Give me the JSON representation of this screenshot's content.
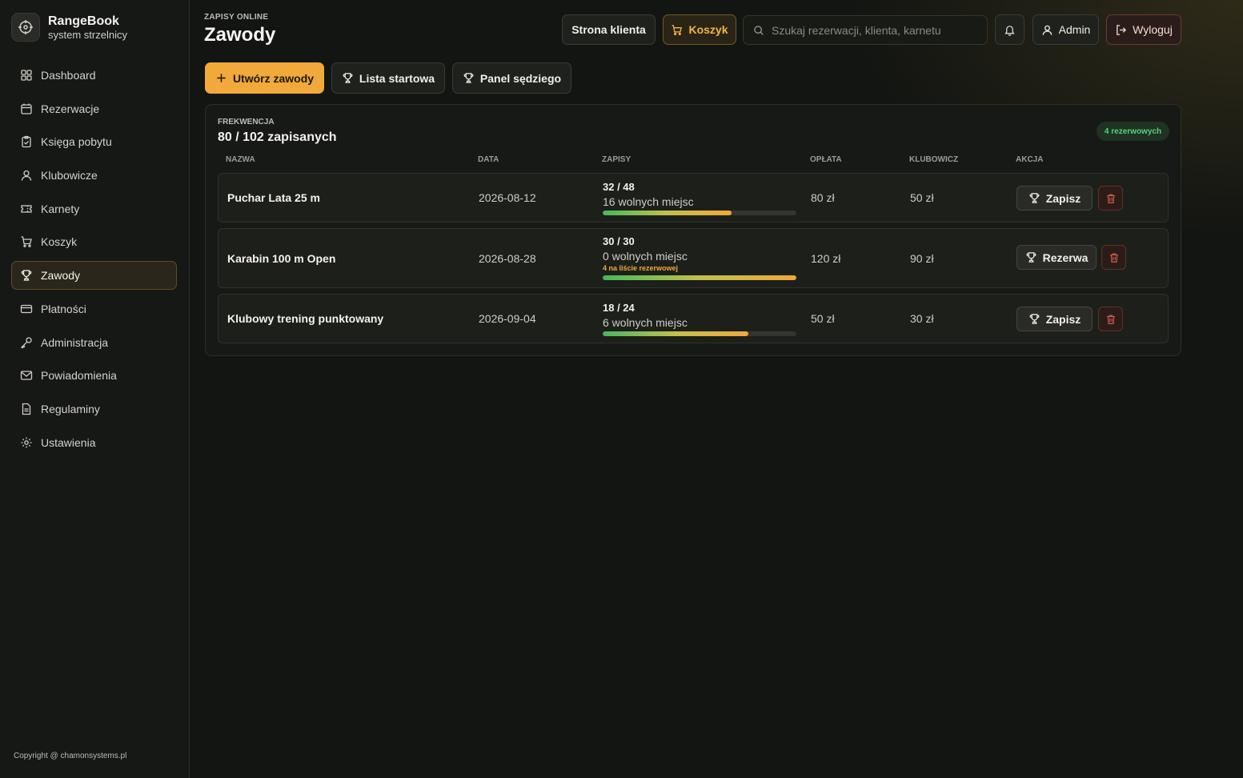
{
  "brand": {
    "name": "RangeBook",
    "subtitle": "system strzelnicy"
  },
  "sidebar": {
    "items": [
      {
        "label": "Dashboard",
        "icon": "dashboard-icon"
      },
      {
        "label": "Rezerwacje",
        "icon": "calendar-icon"
      },
      {
        "label": "Księga pobytu",
        "icon": "clipboard-icon"
      },
      {
        "label": "Klubowicze",
        "icon": "user-icon"
      },
      {
        "label": "Karnety",
        "icon": "ticket-icon"
      },
      {
        "label": "Koszyk",
        "icon": "cart-icon"
      },
      {
        "label": "Zawody",
        "icon": "trophy-icon",
        "active": true
      },
      {
        "label": "Płatności",
        "icon": "card-icon"
      },
      {
        "label": "Administracja",
        "icon": "key-icon"
      },
      {
        "label": "Powiadomienia",
        "icon": "mail-icon"
      },
      {
        "label": "Regulaminy",
        "icon": "document-icon"
      },
      {
        "label": "Ustawienia",
        "icon": "gear-icon"
      }
    ],
    "copyright": "Copyright @ chamonsystems.pl"
  },
  "header": {
    "eyebrow": "ZAPISY ONLINE",
    "title": "Zawody"
  },
  "topbar": {
    "client_label": "Strona klienta",
    "cart_label": "Koszyk",
    "search_placeholder": "Szukaj rezerwacji, klienta, karnetu",
    "admin_label": "Admin",
    "logout_label": "Wyloguj"
  },
  "actions": {
    "create_label": "Utwórz zawody",
    "list_label": "Lista startowa",
    "judge_label": "Panel sędziego"
  },
  "attendance": {
    "eyebrow": "FREKWENCJA",
    "title": "80 / 102 zapisanych",
    "badge": "4 rezerwowych"
  },
  "table": {
    "columns": [
      "NAZWA",
      "DATA",
      "ZAPISY",
      "OPŁATA",
      "KLUBOWICZ",
      "AKCJA"
    ],
    "rows": [
      {
        "name": "Puchar Lata 25 m",
        "date": "2026-08-12",
        "ratio": "32 / 48",
        "free": "16 wolnych miejsc",
        "fill_pct": 66.7,
        "fee": "80 zł",
        "member_fee": "50 zł",
        "action": "Zapisz"
      },
      {
        "name": "Karabin 100 m Open",
        "date": "2026-08-28",
        "ratio": "30 / 30",
        "free": "0 wolnych miejsc",
        "waitlist": "4 na liście rezerwowej",
        "fill_pct": 100,
        "fee": "120 zł",
        "member_fee": "90 zł",
        "action": "Rezerwa"
      },
      {
        "name": "Klubowy trening punktowany",
        "date": "2026-09-04",
        "ratio": "18 / 24",
        "free": "6 wolnych miejsc",
        "fill_pct": 75,
        "fee": "50 zł",
        "member_fee": "30 zł",
        "action": "Zapisz"
      }
    ]
  },
  "colors": {
    "accent": "#f0a93a",
    "success": "#5bd07a",
    "danger": "#d0624c",
    "background": "#131512"
  }
}
